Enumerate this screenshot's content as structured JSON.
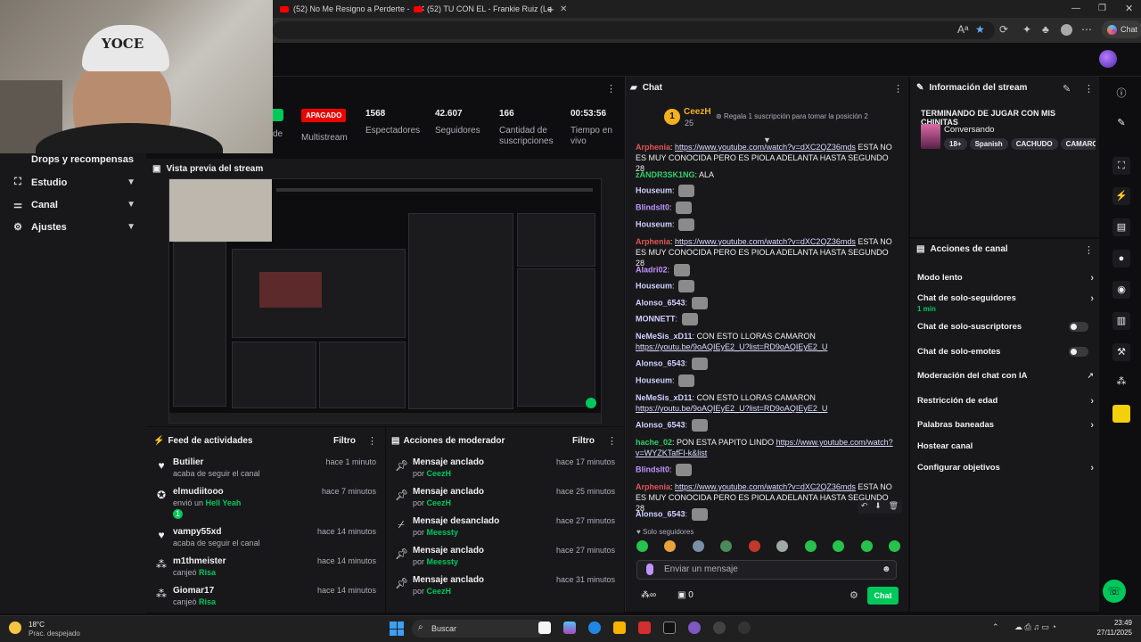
{
  "browser": {
    "tabs": [
      {
        "label": "(52) No Me Resigno a Perderte -"
      },
      {
        "label": "(52) TU CON EL - Frankie Ruiz (Le"
      }
    ],
    "chat_button": "Chat"
  },
  "webcam": {
    "cap_text": "YOCE"
  },
  "sidebar": {
    "items": [
      {
        "label": "Drops y recompensas"
      },
      {
        "label": "Estudio"
      },
      {
        "label": "Canal"
      },
      {
        "label": "Ajustes"
      }
    ]
  },
  "stats": {
    "status": "APAGADO",
    "multistream_label": "Multistream",
    "partial_label": "de",
    "viewers_value": "1568",
    "viewers_label": "Espectadores",
    "followers_value": "42.607",
    "followers_label": "Seguidores",
    "subs_value": "166",
    "subs_label": "Cantidad de suscripciones",
    "time_value": "00:53:56",
    "time_label": "Tiempo en vivo"
  },
  "preview": {
    "title": "Vista previa del stream"
  },
  "activity": {
    "title": "Feed de actividades",
    "filter": "Filtro",
    "rows": [
      {
        "name": "Butilier",
        "sub": "acaba de seguir el canal",
        "time": "hace 1 minuto"
      },
      {
        "name": "elmudiitooo",
        "sub_prefix": "envió un",
        "sub_highlight": "Hell Yeah",
        "time": "hace 7 minutos",
        "count": "1"
      },
      {
        "name": "vampy55xd",
        "sub": "acaba de seguir el canal",
        "time": "hace 14 minutos"
      },
      {
        "name": "m1thmeister",
        "sub_prefix": "canjeó",
        "sub_highlight": "Risa",
        "time": "hace 14 minutos"
      },
      {
        "name": "Giomar17",
        "sub_prefix": "canjeó",
        "sub_highlight": "Risa",
        "time": "hace 14 minutos"
      }
    ]
  },
  "moderator": {
    "title": "Acciones de moderador",
    "filter": "Filtro",
    "rows": [
      {
        "action": "Mensaje anclado",
        "by_prefix": "por",
        "by": "CeezH",
        "time": "hace 17 minutos"
      },
      {
        "action": "Mensaje anclado",
        "by_prefix": "por",
        "by": "CeezH",
        "time": "hace 25 minutos"
      },
      {
        "action": "Mensaje desanclado",
        "by_prefix": "por",
        "by": "Meessty",
        "time": "hace 27 minutos"
      },
      {
        "action": "Mensaje anclado",
        "by_prefix": "por",
        "by": "Meessty",
        "time": "hace 27 minutos"
      },
      {
        "action": "Mensaje anclado",
        "by_prefix": "por",
        "by": "CeezH",
        "time": "hace 31 minutos"
      }
    ]
  },
  "chat": {
    "title": "Chat",
    "top_gifter": "CeezH",
    "top_gifter_count": "25",
    "rank": "1",
    "gift_prompt": "Regala 1 suscripción para tomar la posición 2",
    "messages": [
      {
        "user": "Arphenia",
        "user_color": "#e05555",
        "text": "",
        "link": "https://www.youtube.com/watch?v=dXC2QZ36mds",
        "text2": " ESTA NO ES MUY CONOCIDA PERO ES PIOLA ADELANTA HASTA SEGUNDO 28"
      },
      {
        "user": "zANDR3SK1NG",
        "user_color": "#2fd06b",
        "text": "ALA"
      },
      {
        "user": "Houseum",
        "user_color": "#cfd0ff",
        "emote": true
      },
      {
        "user": "Blindslt0",
        "user_color": "#bf94ff",
        "emote": true
      },
      {
        "user": "Houseum",
        "user_color": "#cfd0ff",
        "emote": true
      },
      {
        "user": "Arphenia",
        "user_color": "#e05555",
        "link": "https://www.youtube.com/watch?v=dXC2QZ36mds",
        "text2": " ESTA NO ES MUY CONOCIDA PERO ES PIOLA ADELANTA HASTA SEGUNDO 28"
      },
      {
        "user": "Aladri02",
        "user_color": "#bf94ff",
        "emote": true
      },
      {
        "user": "Houseum",
        "user_color": "#cfd0ff",
        "emote": true
      },
      {
        "user": "Alonso_6543",
        "user_color": "#cfd0ff",
        "emote": true
      },
      {
        "user": "MONNETT",
        "user_color": "#cfd0ff",
        "emote": true
      },
      {
        "user": "NeMeSis_xD11",
        "user_color": "#cfd0ff",
        "text": "CON ESTO LLORAS CAMARON",
        "link2": "https://youtu.be/9oAQIEyE2_U?list=RD9oAQIEyE2_U"
      },
      {
        "user": "Alonso_6543",
        "user_color": "#cfd0ff",
        "emote": true
      },
      {
        "user": "Houseum",
        "user_color": "#cfd0ff",
        "emote": true
      },
      {
        "user": "NeMeSis_xD11",
        "user_color": "#cfd0ff",
        "text": "CON ESTO LLORAS CAMARON",
        "link2": "https://youtu.be/9oAQIEyE2_U?list=RD9oAQIEyE2_U"
      },
      {
        "user": "Alonso_6543",
        "user_color": "#cfd0ff",
        "emote": true
      },
      {
        "user": "hache_02",
        "user_color": "#2fd06b",
        "text": "PON ESTA PAPITO LINDO",
        "link": "https://www.youtube.com/watch?v=WYZKTafFI-k&list"
      },
      {
        "user": "Blindslt0",
        "user_color": "#bf94ff",
        "emote": true
      },
      {
        "user": "Arphenia",
        "user_color": "#e05555",
        "link": "https://www.youtube.com/watch?v=dXC2QZ36mds",
        "text2": " ESTA NO ES MUY CONOCIDA PERO ES PIOLA ADELANTA HASTA SEGUNDO 28"
      },
      {
        "user": "Alonso_6543",
        "user_color": "#cfd0ff",
        "emote": true
      }
    ],
    "followers_only": "Solo seguidores",
    "input_placeholder": "Enviar un mensaje",
    "points": "0",
    "send_label": "Chat"
  },
  "stream_info": {
    "title": "Información del stream",
    "stream_title": "TERMINANDO DE JUGAR CON MIS CHINITAS",
    "category": "Conversando",
    "tags": [
      "18+",
      "Spanish",
      "CACHUDO",
      "CAMARON"
    ]
  },
  "channel_actions": {
    "title": "Acciones de canal",
    "items": [
      {
        "label": "Modo lento"
      },
      {
        "label": "Chat de solo-seguidores",
        "sub": "1 min"
      },
      {
        "label": "Chat de solo-suscriptores"
      },
      {
        "label": "Chat de solo-emotes"
      },
      {
        "label": "Moderación del chat con IA"
      },
      {
        "label": "Restricción de edad"
      },
      {
        "label": "Palabras baneadas"
      },
      {
        "label": "Hostear canal"
      },
      {
        "label": "Configurar objetivos"
      }
    ]
  },
  "taskbar": {
    "temp": "18°C",
    "weather": "Prac. despejado",
    "search": "Buscar",
    "time": "23:49",
    "date": "27/11/2025"
  },
  "colors": {
    "accent": "#00c85a",
    "live_red": "#eb0400",
    "panel": "#18181b",
    "bg": "#0e0e10"
  }
}
